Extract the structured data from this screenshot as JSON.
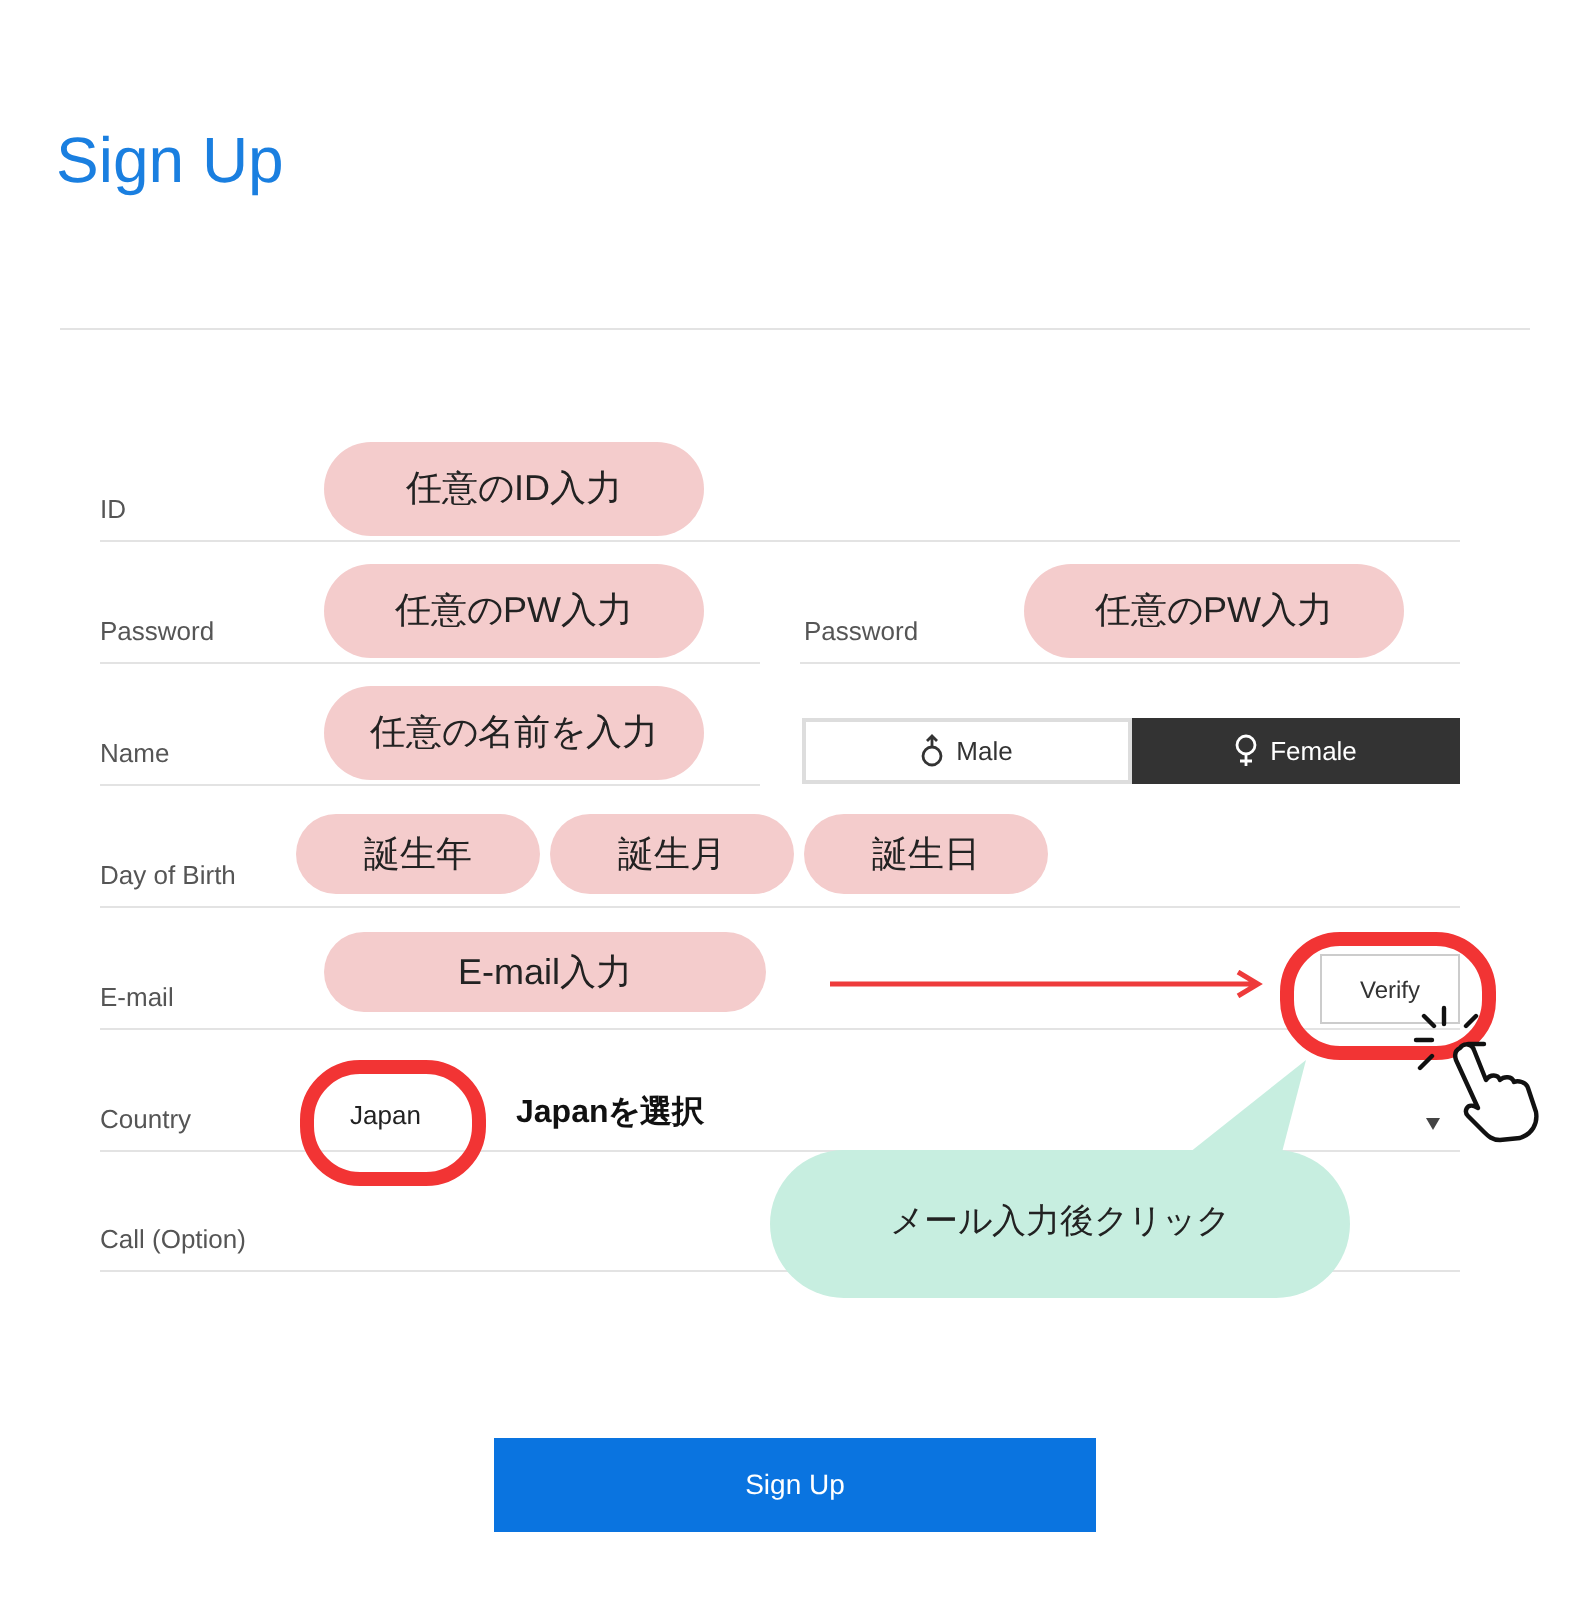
{
  "title": "Sign Up",
  "rows": [
    {
      "kind": "text",
      "label": "ID",
      "annotation": "任意のID入力"
    },
    {
      "kind": "pair",
      "label": "Password",
      "annotation": "任意のPW入力",
      "right": {
        "label": "Password",
        "annotation": "任意のPW入力"
      }
    },
    {
      "kind": "gender",
      "label": "Name",
      "annotation": "任意の名前を入力",
      "options": [
        {
          "kind": "male",
          "label": "Male",
          "selected": false
        },
        {
          "kind": "female",
          "label": "Female",
          "selected": true
        }
      ]
    },
    {
      "kind": "date",
      "label": "Day of Birth",
      "annotations": [
        "誕生年",
        "誕生月",
        "誕生日"
      ]
    },
    {
      "kind": "email",
      "label": "E-mail",
      "annotation": "E-mail入力",
      "button": "Verify"
    },
    {
      "kind": "country",
      "label": "Country",
      "value": "Japan",
      "note": "Japanを選択"
    },
    {
      "kind": "plain",
      "label": "Call (Option)"
    }
  ],
  "callout": "メール入力後クリック",
  "submit": "Sign Up"
}
